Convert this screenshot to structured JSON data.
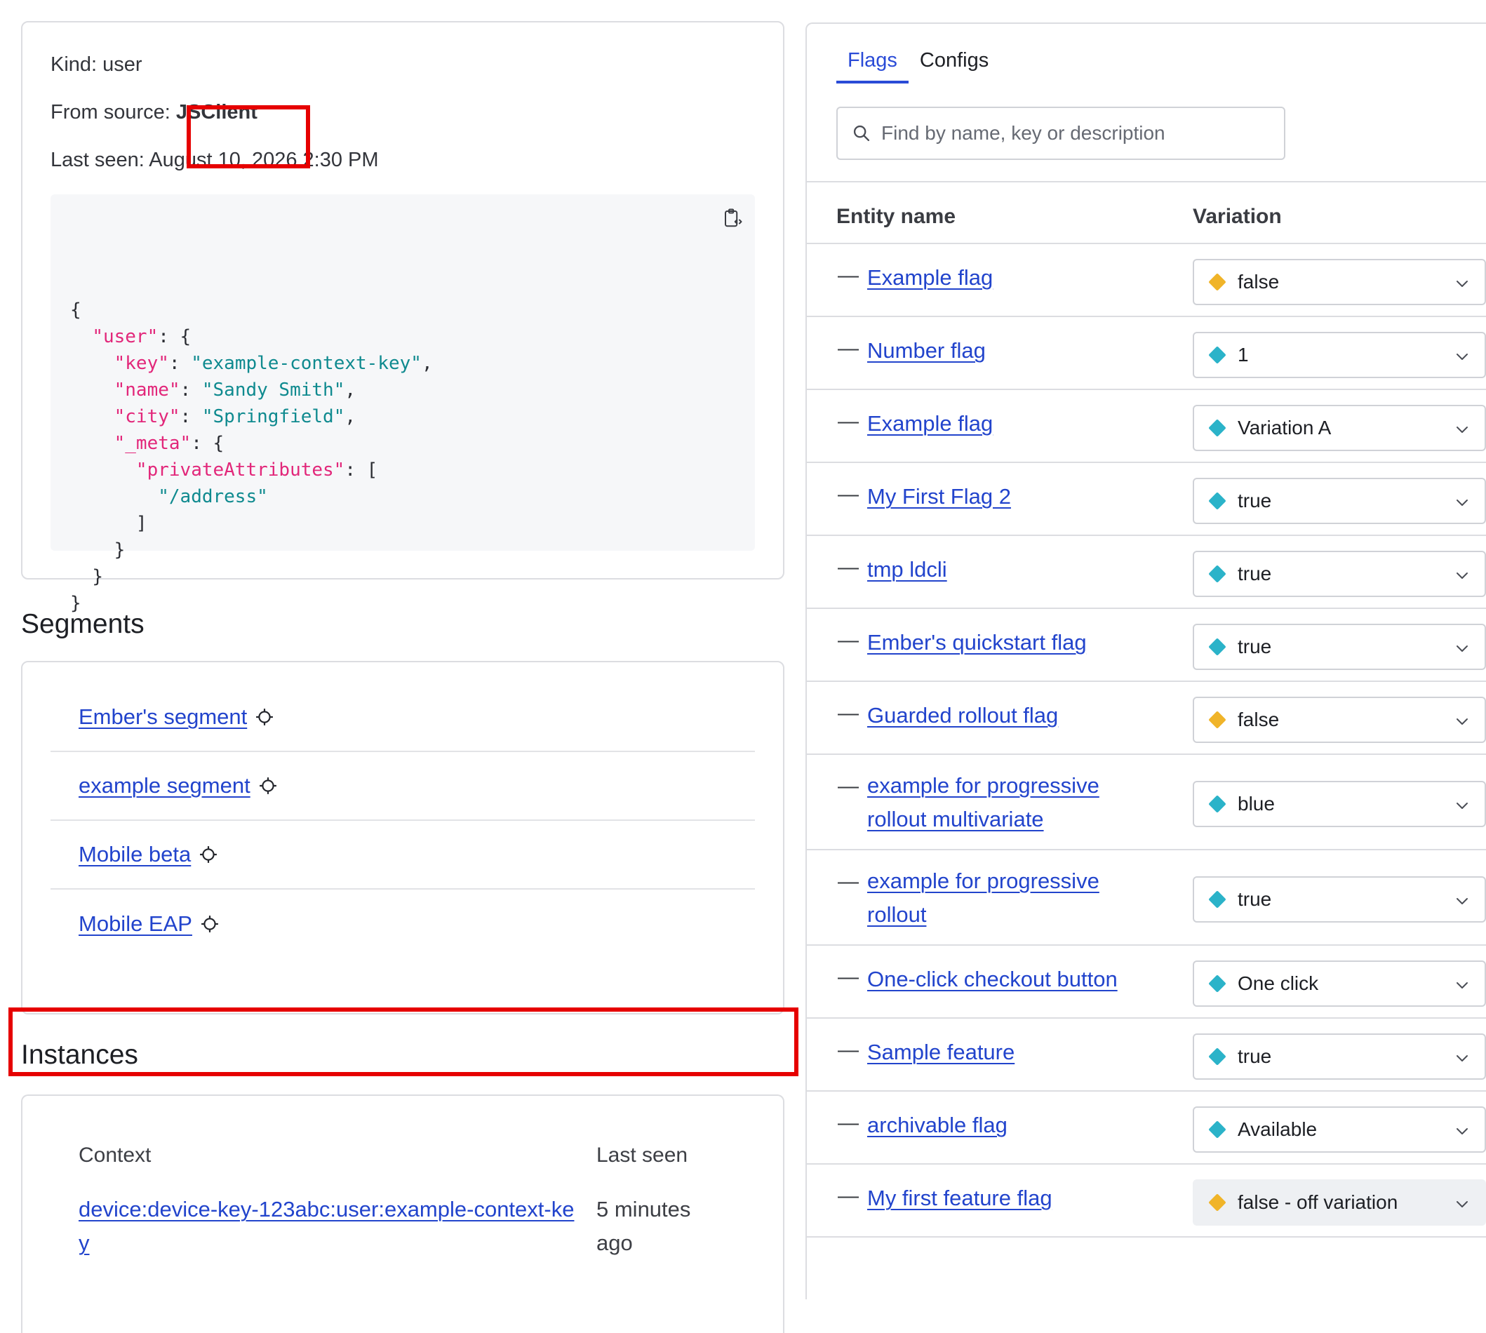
{
  "context": {
    "kind_label": "Kind: user",
    "source_prefix": "From source: ",
    "source_value": "JSClient",
    "last_seen": "Last seen: August 10, 2026 2:30 PM"
  },
  "json_lines": [
    {
      "indent": 0,
      "parts": [
        {
          "t": "p",
          "v": "{"
        }
      ]
    },
    {
      "indent": 1,
      "parts": [
        {
          "t": "k",
          "v": "\"user\""
        },
        {
          "t": "p",
          "v": ": {"
        }
      ]
    },
    {
      "indent": 2,
      "parts": [
        {
          "t": "k",
          "v": "\"key\""
        },
        {
          "t": "p",
          "v": ": "
        },
        {
          "t": "s",
          "v": "\"example-context-key\""
        },
        {
          "t": "p",
          "v": ","
        }
      ]
    },
    {
      "indent": 2,
      "parts": [
        {
          "t": "k",
          "v": "\"name\""
        },
        {
          "t": "p",
          "v": ": "
        },
        {
          "t": "s",
          "v": "\"Sandy Smith\""
        },
        {
          "t": "p",
          "v": ","
        }
      ]
    },
    {
      "indent": 2,
      "parts": [
        {
          "t": "k",
          "v": "\"city\""
        },
        {
          "t": "p",
          "v": ": "
        },
        {
          "t": "s",
          "v": "\"Springfield\""
        },
        {
          "t": "p",
          "v": ","
        }
      ]
    },
    {
      "indent": 2,
      "parts": [
        {
          "t": "k",
          "v": "\"_meta\""
        },
        {
          "t": "p",
          "v": ": {"
        }
      ]
    },
    {
      "indent": 3,
      "parts": [
        {
          "t": "k",
          "v": "\"privateAttributes\""
        },
        {
          "t": "p",
          "v": ": ["
        }
      ]
    },
    {
      "indent": 4,
      "parts": [
        {
          "t": "s",
          "v": "\"/address\""
        }
      ]
    },
    {
      "indent": 3,
      "parts": [
        {
          "t": "p",
          "v": "]"
        }
      ]
    },
    {
      "indent": 2,
      "parts": [
        {
          "t": "p",
          "v": "}"
        }
      ]
    },
    {
      "indent": 1,
      "parts": [
        {
          "t": "p",
          "v": "}"
        }
      ]
    },
    {
      "indent": 0,
      "parts": [
        {
          "t": "p",
          "v": "}"
        }
      ]
    }
  ],
  "segments": {
    "heading": "Segments",
    "items": [
      "Ember's segment",
      "example segment",
      "Mobile beta",
      "Mobile EAP"
    ]
  },
  "instances": {
    "heading": "Instances",
    "col_context": "Context",
    "col_last_seen": "Last seen",
    "rows": [
      {
        "context": "device:device-key-123abc:user:example-context-key",
        "last_seen": "5 minutes ago"
      }
    ]
  },
  "flags_panel": {
    "tabs": [
      "Flags",
      "Configs"
    ],
    "active_tab": 0,
    "search_placeholder": "Find by name, key or description",
    "col_entity": "Entity name",
    "col_variation": "Variation",
    "colors": {
      "yellow": "#f0b429",
      "teal": "#2bb3c9"
    },
    "rows": [
      {
        "name": "Example flag",
        "variation": "false",
        "color": "yellow",
        "lines": 1
      },
      {
        "name": "Number flag",
        "variation": "1",
        "color": "teal",
        "lines": 1
      },
      {
        "name": "Example flag",
        "variation": "Variation A",
        "color": "teal",
        "lines": 1
      },
      {
        "name": "My First Flag 2",
        "variation": "true",
        "color": "teal",
        "lines": 1
      },
      {
        "name": "tmp ldcli",
        "variation": "true",
        "color": "teal",
        "lines": 1
      },
      {
        "name": "Ember's quickstart flag",
        "variation": "true",
        "color": "teal",
        "lines": 1
      },
      {
        "name": "Guarded rollout flag",
        "variation": "false",
        "color": "yellow",
        "lines": 1
      },
      {
        "name": "example for progressive rollout multivariate",
        "variation": "blue",
        "color": "teal",
        "lines": 2
      },
      {
        "name": "example for progressive rollout",
        "variation": "true",
        "color": "teal",
        "lines": 2
      },
      {
        "name": "One-click checkout button",
        "variation": "One click",
        "color": "teal",
        "lines": 1
      },
      {
        "name": "Sample feature",
        "variation": "true",
        "color": "teal",
        "lines": 1
      },
      {
        "name": "archivable flag",
        "variation": "Available",
        "color": "teal",
        "lines": 1
      },
      {
        "name": "My first feature flag",
        "variation": "false - off variation",
        "color": "yellow",
        "lines": 1,
        "off": true
      }
    ]
  }
}
